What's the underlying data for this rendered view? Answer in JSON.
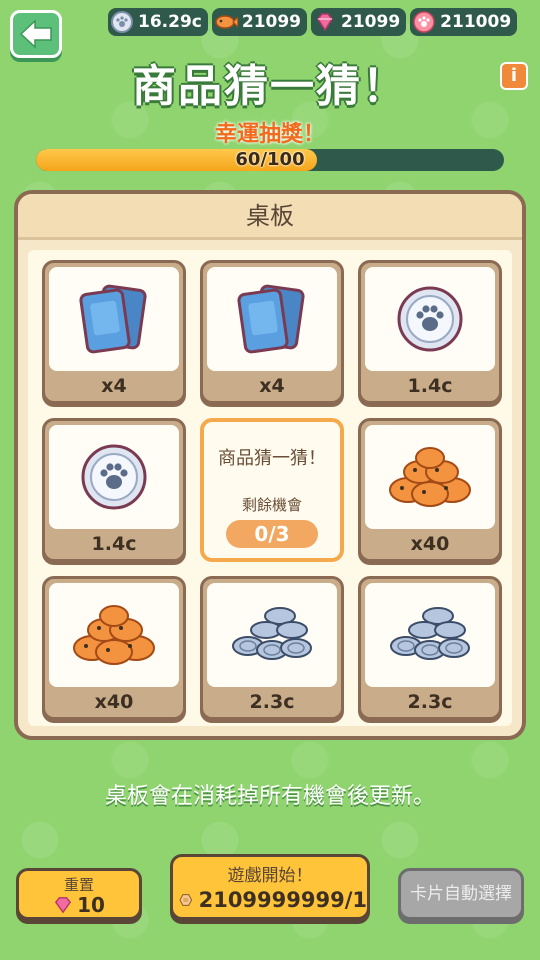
{
  "header": {
    "currencies": [
      {
        "icon": "paw-coin-icon",
        "value": "16.29c"
      },
      {
        "icon": "fish-icon",
        "value": "21099"
      },
      {
        "icon": "gem-icon",
        "value": "21099"
      },
      {
        "icon": "paw-token-icon",
        "value": "211009"
      }
    ],
    "title": "商品猜一猜！",
    "info_label": "i"
  },
  "lucky": {
    "label": "幸運抽獎！",
    "progress_text": "60/100",
    "progress_fraction": 0.6
  },
  "board": {
    "title": "桌板",
    "cards": [
      {
        "item": "card-pack",
        "qty": "x4"
      },
      {
        "item": "card-pack",
        "qty": "x4"
      },
      {
        "item": "paw-coin",
        "qty": "1.4c"
      },
      {
        "item": "paw-coin",
        "qty": "1.4c"
      },
      {
        "item": "guess-panel"
      },
      {
        "item": "fish-pile",
        "qty": "x40"
      },
      {
        "item": "fish-pile",
        "qty": "x40"
      },
      {
        "item": "coin-stack",
        "qty": "2.3c"
      },
      {
        "item": "coin-stack",
        "qty": "2.3c"
      }
    ],
    "special": {
      "title": "商品猜一猜！",
      "subtitle": "剩餘機會",
      "count": "0/3"
    }
  },
  "note": "桌板會在消耗掉所有機會後更新。",
  "buttons": {
    "reset_label": "重置",
    "reset_cost": "10",
    "start_label": "遊戲開始！",
    "start_cost": "2109999999/1",
    "auto_label": "卡片自動選擇"
  },
  "colors": {
    "background": "#8fd46f",
    "accent_orange": "#f26b1d",
    "button_yellow": "#ffc43a",
    "board_frame": "#8a6a52"
  }
}
